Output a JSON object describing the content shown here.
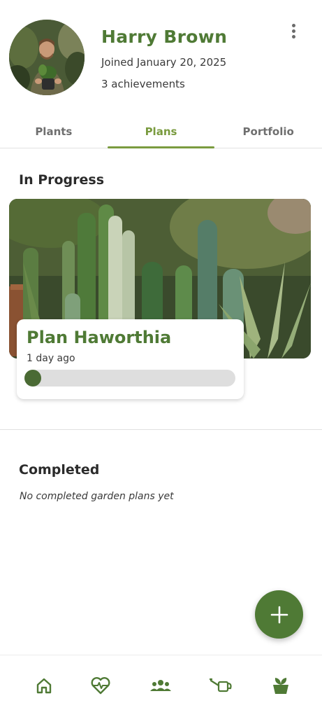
{
  "profile": {
    "name": "Harry Brown",
    "joined": "Joined January 20, 2025",
    "achievements": "3 achievements"
  },
  "tabs": [
    {
      "label": "Plants",
      "active": false
    },
    {
      "label": "Plans",
      "active": true
    },
    {
      "label": "Portfolio",
      "active": false
    }
  ],
  "in_progress": {
    "title": "In Progress",
    "plans": [
      {
        "title": "Plan Haworthia",
        "time": "1 day ago",
        "progress": 0.05
      }
    ]
  },
  "completed": {
    "title": "Completed",
    "empty_text": "No completed garden plans yet"
  },
  "icons": {
    "more": "more-vertical-icon",
    "fab": "plus-icon",
    "nav": [
      "home-icon",
      "heart-pulse-icon",
      "community-icon",
      "watering-can-icon",
      "plant-pot-icon"
    ]
  },
  "colors": {
    "brand_green": "#4f7a35",
    "tab_active": "#7a9b3f",
    "progress_fill": "#4a6a34",
    "progress_track": "#dedede"
  }
}
